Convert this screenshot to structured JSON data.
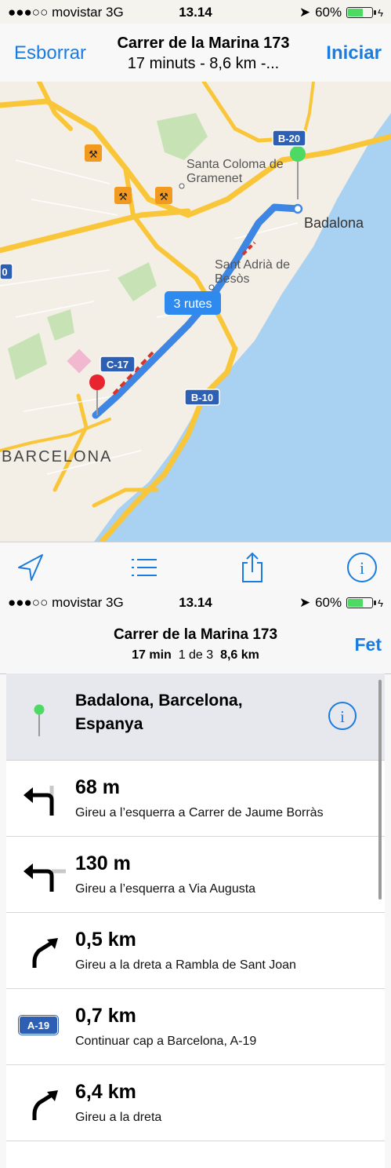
{
  "top": {
    "status": {
      "carrier": "●●●○○ movistar  3G",
      "time": "13.14",
      "battery": "60%"
    },
    "nav": {
      "left_button": "Esborrar",
      "title": "Carrer de la Marina 173",
      "subtitle": "17 minuts - 8,6 km -...",
      "right_button": "Iniciar"
    },
    "map": {
      "labels": {
        "santa_coloma": "Santa Coloma de",
        "gramenet": "Gramenet",
        "badalona": "Badalona",
        "sant_adria": "Sant Adrià de",
        "besos": "Besòs",
        "barcelona": "BARCELONA",
        "routes_badge": "3 rutes",
        "shield_b20": "B-20",
        "shield_c17": "C-17",
        "shield_b10": "B-10",
        "edge_0": "0"
      },
      "colors": {
        "water": "#a8d1f2",
        "land": "#f3efe6",
        "road": "#f9c63a",
        "route": "#3e86e3",
        "park": "#c7e3b5"
      }
    },
    "toolbar": {
      "icons": [
        "location-arrow-icon",
        "list-icon",
        "share-icon",
        "info-icon"
      ]
    }
  },
  "bottom": {
    "status": {
      "carrier": "●●●○○ movistar  3G",
      "time": "13.14",
      "battery": "60%"
    },
    "nav": {
      "title": "Carrer de la Marina 173",
      "time": "17 min",
      "route_index": "1 de 3",
      "distance": "8,6 km",
      "done_button": "Fet"
    },
    "destination": {
      "line1": "Badalona, Barcelona,",
      "line2": "Espanya"
    },
    "steps": [
      {
        "icon": "turn-left-icon",
        "distance": "68 m",
        "instruction": "Gireu a l’esquerra a Carrer de Jaume Borràs"
      },
      {
        "icon": "turn-left-icon",
        "distance": "130 m",
        "instruction": "Gireu a l’esquerra a Via Augusta"
      },
      {
        "icon": "bear-right-icon",
        "distance": "0,5 km",
        "instruction": "Gireu a la dreta a Rambla de Sant Joan"
      },
      {
        "icon": "highway-shield-icon",
        "shield": "A-19",
        "distance": "0,7 km",
        "instruction": "Continuar cap a Barcelona, A-19"
      },
      {
        "icon": "bear-right-icon",
        "distance": "6,4 km",
        "instruction": "Gireu a la dreta"
      }
    ]
  }
}
